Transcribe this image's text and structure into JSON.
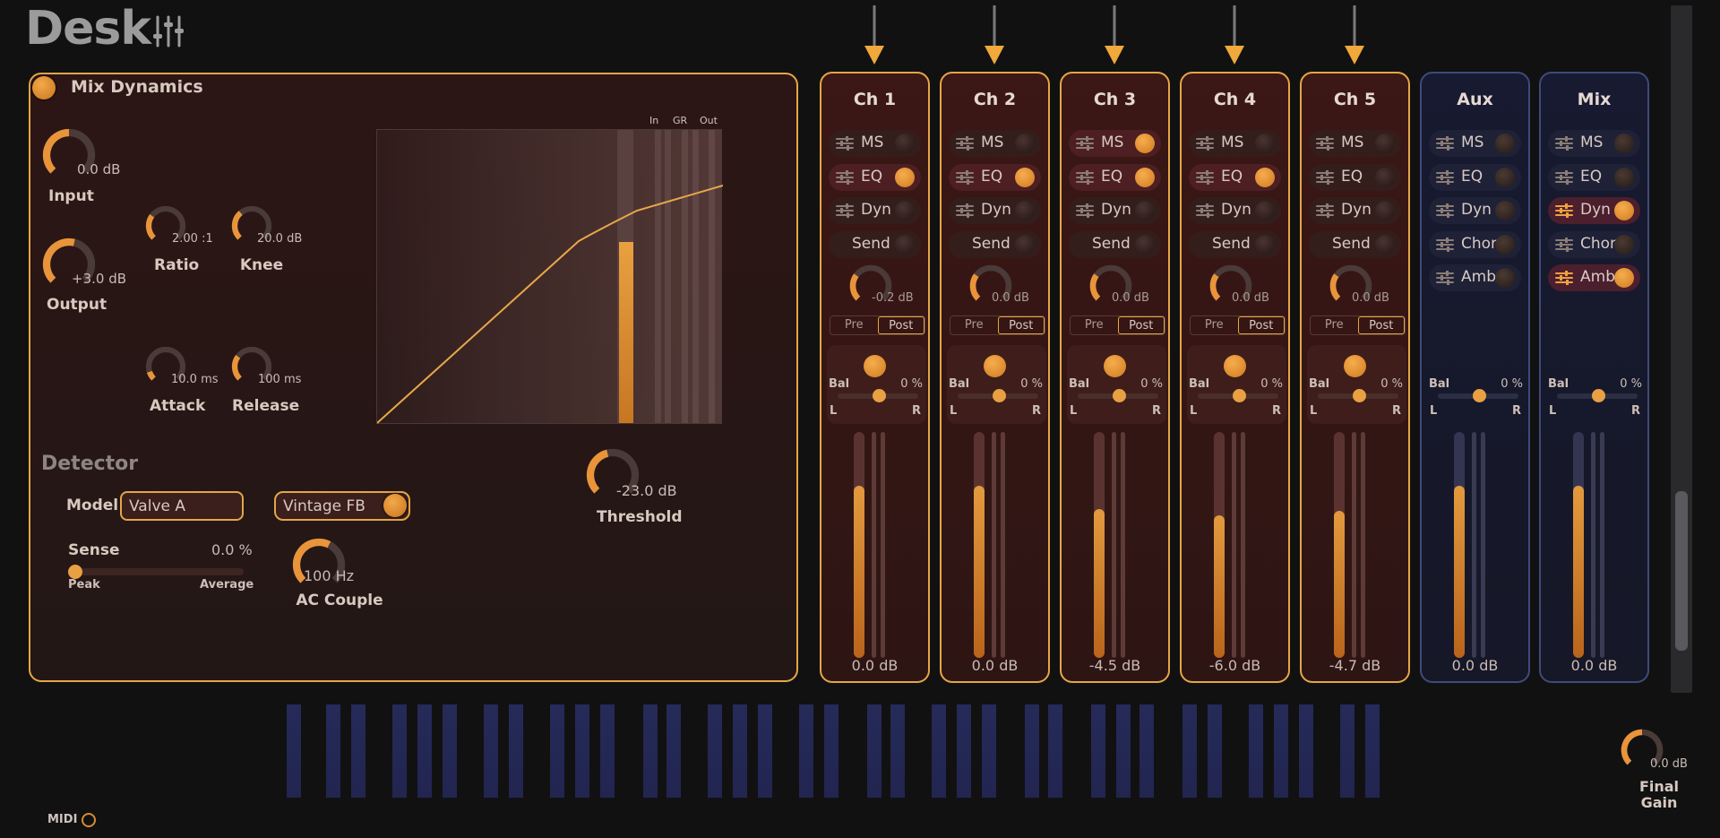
{
  "app": {
    "title": "Desk"
  },
  "dynamics": {
    "title": "Mix Dynamics",
    "input": {
      "label": "Input",
      "value": "0.0 dB",
      "level": 0.5
    },
    "output": {
      "label": "Output",
      "value": "+3.0 dB",
      "level": 0.55
    },
    "ratio": {
      "label": "Ratio",
      "value": "2.00 :1",
      "level": 0.3
    },
    "knee": {
      "label": "Knee",
      "value": "20.0 dB",
      "level": 0.35
    },
    "attack": {
      "label": "Attack",
      "value": "10.0 ms",
      "level": 0.1
    },
    "release": {
      "label": "Release",
      "value": "100 ms",
      "level": 0.3
    },
    "threshold": {
      "label": "Threshold",
      "value": "-23.0 dB",
      "level": 0.45
    },
    "meter_labels": [
      "In",
      "GR",
      "Out"
    ],
    "detector": {
      "heading": "Detector",
      "model_label": "Model",
      "model_value": "Valve A",
      "vintage_label": "Vintage FB",
      "sense_label": "Sense",
      "sense_value": "0.0 %",
      "sense_min": "Peak",
      "sense_max": "Average",
      "ac_value": "100 Hz",
      "ac_label": "AC Couple"
    }
  },
  "channels": [
    {
      "name": "Ch 1",
      "type": "channel",
      "fx": [
        {
          "label": "MS",
          "on": false
        },
        {
          "label": "EQ",
          "on": true
        },
        {
          "label": "Dyn",
          "on": false
        }
      ],
      "send_label": "Send",
      "send_value": "-0.2 dB",
      "pre": "Pre",
      "post": "Post",
      "bal_label": "Bal",
      "bal_value": "0 %",
      "left": "L",
      "right": "R",
      "fader_level": 0.76,
      "db": "0.0 dB"
    },
    {
      "name": "Ch 2",
      "type": "channel",
      "fx": [
        {
          "label": "MS",
          "on": false
        },
        {
          "label": "EQ",
          "on": true
        },
        {
          "label": "Dyn",
          "on": false
        }
      ],
      "send_label": "Send",
      "send_value": "0.0 dB",
      "pre": "Pre",
      "post": "Post",
      "bal_label": "Bal",
      "bal_value": "0 %",
      "left": "L",
      "right": "R",
      "fader_level": 0.76,
      "db": "0.0 dB"
    },
    {
      "name": "Ch 3",
      "type": "channel",
      "fx": [
        {
          "label": "MS",
          "on": true
        },
        {
          "label": "EQ",
          "on": true
        },
        {
          "label": "Dyn",
          "on": false
        }
      ],
      "send_label": "Send",
      "send_value": "0.0 dB",
      "pre": "Pre",
      "post": "Post",
      "bal_label": "Bal",
      "bal_value": "0 %",
      "left": "L",
      "right": "R",
      "fader_level": 0.66,
      "db": "-4.5 dB"
    },
    {
      "name": "Ch 4",
      "type": "channel",
      "fx": [
        {
          "label": "MS",
          "on": false
        },
        {
          "label": "EQ",
          "on": true
        },
        {
          "label": "Dyn",
          "on": false
        }
      ],
      "send_label": "Send",
      "send_value": "0.0 dB",
      "pre": "Pre",
      "post": "Post",
      "bal_label": "Bal",
      "bal_value": "0 %",
      "left": "L",
      "right": "R",
      "fader_level": 0.63,
      "db": "-6.0 dB"
    },
    {
      "name": "Ch 5",
      "type": "channel",
      "fx": [
        {
          "label": "MS",
          "on": false
        },
        {
          "label": "EQ",
          "on": false
        },
        {
          "label": "Dyn",
          "on": false
        }
      ],
      "send_label": "Send",
      "send_value": "0.0 dB",
      "pre": "Pre",
      "post": "Post",
      "bal_label": "Bal",
      "bal_value": "0 %",
      "left": "L",
      "right": "R",
      "fader_level": 0.65,
      "db": "-4.7 dB"
    },
    {
      "name": "Aux",
      "type": "bus",
      "fx": [
        {
          "label": "MS",
          "on": false
        },
        {
          "label": "EQ",
          "on": false
        },
        {
          "label": "Dyn",
          "on": false
        },
        {
          "label": "Chor",
          "on": false
        },
        {
          "label": "Amb",
          "on": false
        }
      ],
      "bal_label": "Bal",
      "bal_value": "0 %",
      "left": "L",
      "right": "R",
      "fader_level": 0.76,
      "db": "0.0 dB"
    },
    {
      "name": "Mix",
      "type": "bus",
      "fx": [
        {
          "label": "MS",
          "on": false
        },
        {
          "label": "EQ",
          "on": false
        },
        {
          "label": "Dyn",
          "on": true
        },
        {
          "label": "Chor",
          "on": false
        },
        {
          "label": "Amb",
          "on": true
        }
      ],
      "bal_label": "Bal",
      "bal_value": "0 %",
      "left": "L",
      "right": "R",
      "fader_level": 0.76,
      "db": "0.0 dB"
    }
  ],
  "footer": {
    "midi_label": "MIDI",
    "final_gain_value": "0.0 dB",
    "final_gain_label": "Final\nGain",
    "final_gain_level": 0.5
  },
  "colors": {
    "accent": "#e4a646",
    "knob": "#e9943a",
    "bus_border": "#3f4a7b",
    "keys": "#232652"
  }
}
